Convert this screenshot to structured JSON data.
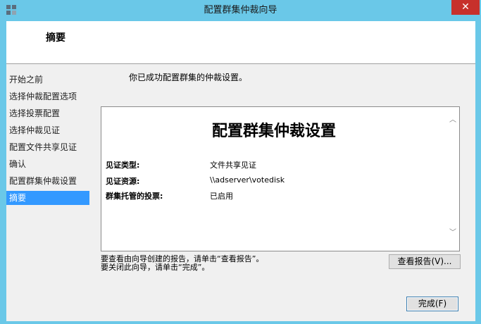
{
  "window": {
    "title": "配置群集仲裁向导",
    "close_label": "✕"
  },
  "header": {
    "title": "摘要"
  },
  "sidebar": {
    "items": [
      {
        "label": "开始之前",
        "active": false
      },
      {
        "label": "选择仲裁配置选项",
        "active": false
      },
      {
        "label": "选择投票配置",
        "active": false
      },
      {
        "label": "选择仲裁见证",
        "active": false
      },
      {
        "label": "配置文件共享见证",
        "active": false
      },
      {
        "label": "确认",
        "active": false
      },
      {
        "label": "配置群集仲裁设置",
        "active": false
      },
      {
        "label": "摘要",
        "active": true
      }
    ]
  },
  "main": {
    "success_message": "你已成功配置群集的仲裁设置。",
    "report": {
      "title": "配置群集仲裁设置",
      "rows": [
        {
          "label": "见证类型:",
          "value": "文件共享见证"
        },
        {
          "label": "见证资源:",
          "value": "\\\\adserver\\votedisk"
        },
        {
          "label": "群集托管的投票:",
          "value": "已启用"
        }
      ]
    },
    "hint_line1": "要查看由向导创建的报告，请单击“查看报告”。",
    "hint_line2": "要关闭此向导，请单击“完成”。",
    "view_report_button": "查看报告(V)...",
    "finish_button": "完成(F)"
  },
  "colors": {
    "titlebar": "#6ac8e8",
    "active_step": "#3399ff",
    "close": "#c7302b"
  }
}
